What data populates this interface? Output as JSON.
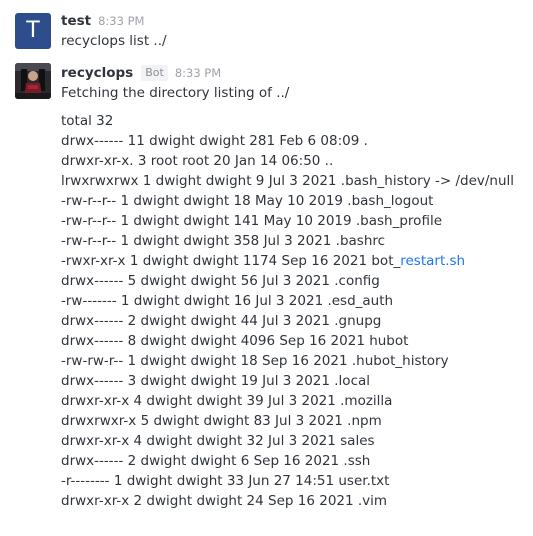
{
  "messages": [
    {
      "username": "test",
      "avatar_letter": "T",
      "avatar_color": "#2d4d8c",
      "time": "8:33 PM",
      "text": "recyclops list ../"
    },
    {
      "username": "recyclops",
      "badge": "Bot",
      "time": "8:33 PM",
      "intro": "Fetching the directory listing of ../",
      "lines": [
        "total 32",
        "drwx------ 11 dwight dwight 281 Feb 6 08:09 .",
        "drwxr-xr-x. 3 root root 20 Jan 14 06:50 ..",
        "lrwxrwxrwx 1 dwight dwight 9 Jul 3 2021 .bash_history -> /dev/null",
        "-rw-r--r-- 1 dwight dwight 18 May 10 2019 .bash_logout",
        "-rw-r--r-- 1 dwight dwight 141 May 10 2019 .bash_profile",
        "-rw-r--r-- 1 dwight dwight 358 Jul 3 2021 .bashrc",
        {
          "prefix": "-rwxr-xr-x 1 dwight dwight 1174 Sep 16 2021 bot_",
          "link": "restart.sh"
        },
        "drwx------ 5 dwight dwight 56 Jul 3 2021 .config",
        "-rw------- 1 dwight dwight 16 Jul 3 2021 .esd_auth",
        "drwx------ 2 dwight dwight 44 Jul 3 2021 .gnupg",
        "drwx------ 8 dwight dwight 4096 Sep 16 2021 hubot",
        "-rw-rw-r-- 1 dwight dwight 18 Sep 16 2021 .hubot_history",
        "drwx------ 3 dwight dwight 19 Jul 3 2021 .local",
        "drwxr-xr-x 4 dwight dwight 39 Jul 3 2021 .mozilla",
        "drwxrwxr-x 5 dwight dwight 83 Jul 3 2021 .npm",
        "drwxr-xr-x 4 dwight dwight 32 Jul 3 2021 sales",
        "drwx------ 2 dwight dwight 6 Sep 16 2021 .ssh",
        "-r-------- 1 dwight dwight 33 Jun 27 14:51 user.txt",
        "drwxr-xr-x 2 dwight dwight 24 Sep 16 2021 .vim"
      ]
    }
  ],
  "link_color": "#1d74f5"
}
